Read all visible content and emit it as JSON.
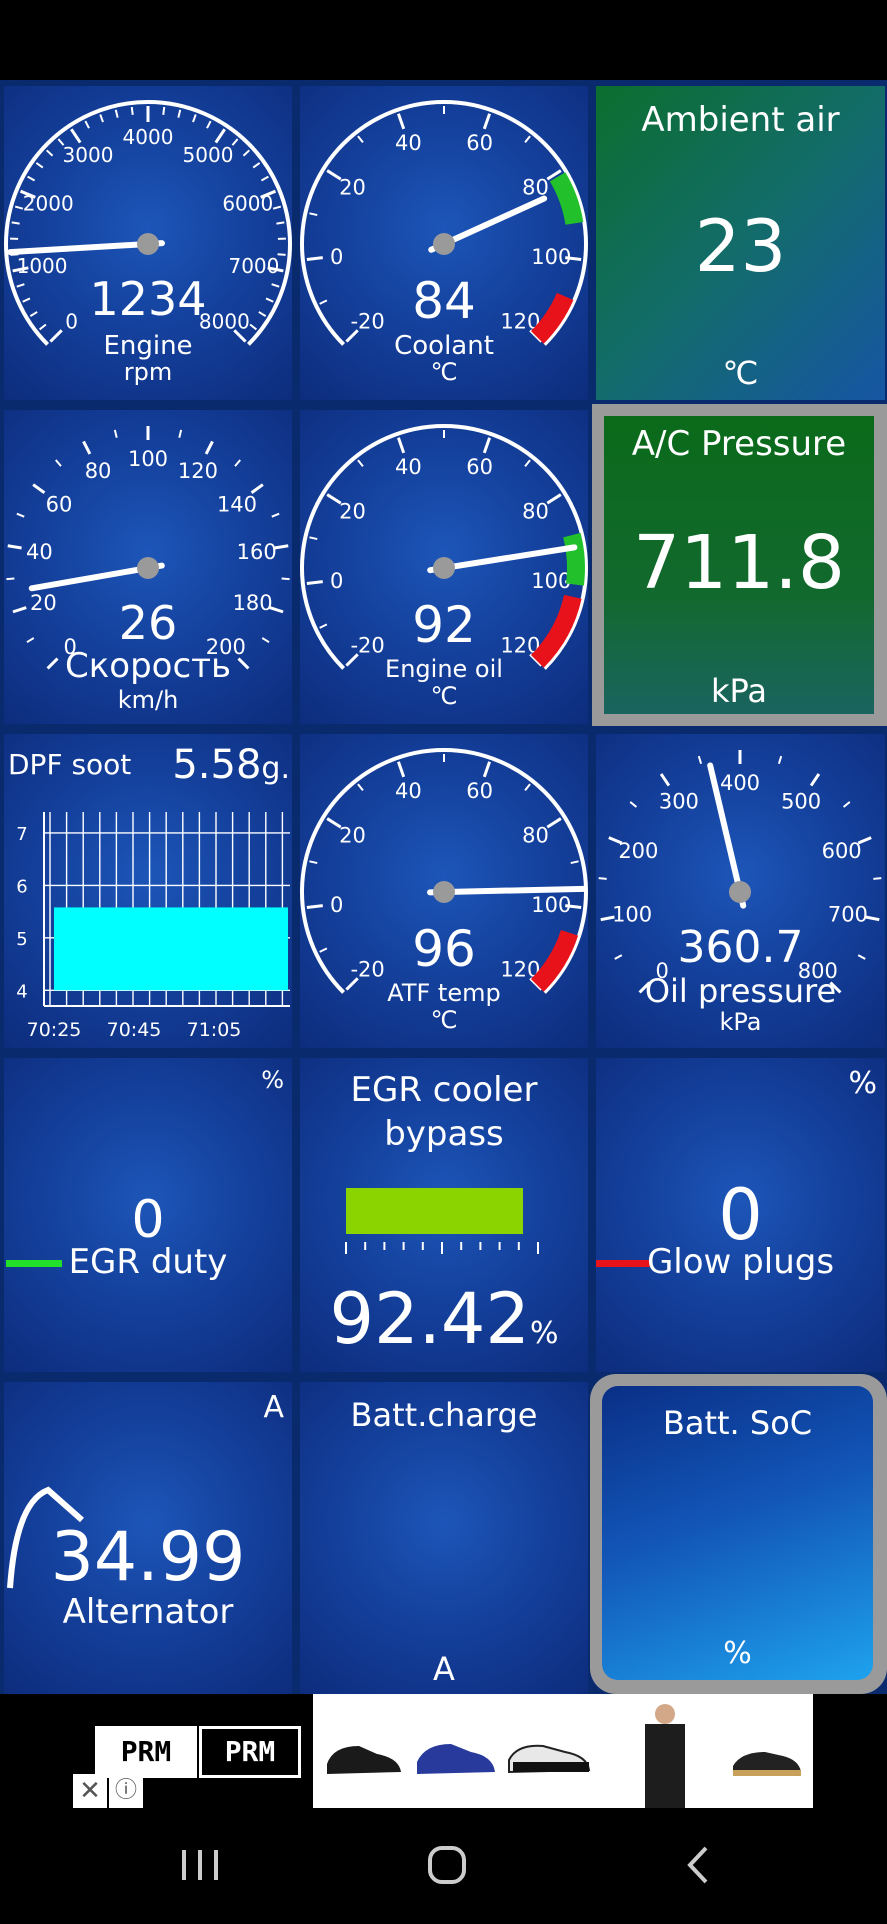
{
  "tiles": {
    "rpm": {
      "value": "1234",
      "label": "Engine",
      "unit": "rpm",
      "ticks": [
        "0",
        "1000",
        "2000",
        "3000",
        "4000",
        "5000",
        "6000",
        "7000",
        "8000"
      ],
      "reading": 1234
    },
    "coolant": {
      "value": "84",
      "label": "Coolant",
      "unit": "℃",
      "ticks": [
        "-20",
        "0",
        "20",
        "40",
        "60",
        "80",
        "100",
        "120"
      ],
      "reading": 84
    },
    "ambient": {
      "title": "Ambient air",
      "value": "23",
      "unit": "℃"
    },
    "speed": {
      "value": "26",
      "label": "Скорость",
      "unit": "km/h",
      "ticks": [
        "0",
        "20",
        "40",
        "60",
        "80",
        "100",
        "120",
        "140",
        "160",
        "180",
        "200"
      ],
      "reading": 26
    },
    "engine_oil": {
      "value": "92",
      "label": "Engine oil",
      "unit": "℃",
      "ticks": [
        "-20",
        "0",
        "20",
        "40",
        "60",
        "80",
        "100",
        "120"
      ],
      "reading": 92
    },
    "ac_pressure": {
      "title": "A/C Pressure",
      "value": "711.8",
      "unit": "kPa"
    },
    "dpf": {
      "title": "DPF soot",
      "value": "5.58",
      "unit": "g.",
      "y_ticks": [
        "7",
        "6",
        "5",
        "4"
      ],
      "x_ticks": [
        "70:25",
        "70:45",
        "71:05"
      ]
    },
    "atf": {
      "value": "96",
      "label": "ATF temp",
      "unit": "℃",
      "ticks": [
        "-20",
        "0",
        "20",
        "40",
        "60",
        "80",
        "100",
        "120"
      ],
      "reading": 96
    },
    "oil_pressure": {
      "value": "360.7",
      "label": "Oil pressure",
      "unit": "kPa",
      "ticks": [
        "0",
        "100",
        "200",
        "300",
        "400",
        "500",
        "600",
        "700",
        "800"
      ],
      "reading": 360.7
    },
    "egr_duty": {
      "value": "0",
      "label": "EGR duty",
      "unit": "%"
    },
    "egr_bypass": {
      "title_line1": "EGR cooler",
      "title_line2": "bypass",
      "value": "92.42",
      "unit": "%",
      "level": 0.9242
    },
    "glow_plugs": {
      "value": "0",
      "label": "Glow plugs",
      "unit": "%"
    },
    "alternator": {
      "value": "34.99",
      "label": "Alternator",
      "unit": "A"
    },
    "batt_charge": {
      "title": "Batt.charge",
      "unit": "A"
    },
    "batt_soc": {
      "title": "Batt. SoC",
      "unit": "%"
    }
  },
  "ad": {
    "logo1": "PRM",
    "logo2": "PRM"
  },
  "colors": {
    "green_zone": "#22c02a",
    "red_zone": "#e8121a",
    "cyan_bar": "#00ffff",
    "lime_bar": "#8cd400"
  }
}
